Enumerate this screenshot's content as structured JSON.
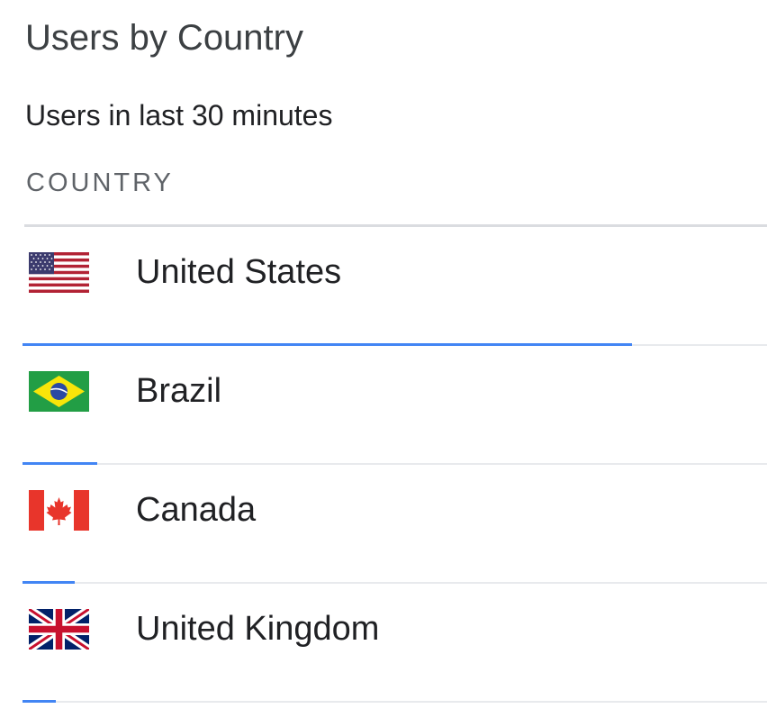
{
  "card": {
    "title": "Users by Country",
    "subtitle": "Users in last 30 minutes",
    "column_header": "COUNTRY"
  },
  "accent_color": "#4285f4",
  "rows": [
    {
      "country": "United States",
      "flag_icon": "us-flag-icon",
      "relative_share": 0.82
    },
    {
      "country": "Brazil",
      "flag_icon": "brazil-flag-icon",
      "relative_share": 0.1
    },
    {
      "country": "Canada",
      "flag_icon": "canada-flag-icon",
      "relative_share": 0.07
    },
    {
      "country": "United Kingdom",
      "flag_icon": "uk-flag-icon",
      "relative_share": 0.045
    }
  ]
}
